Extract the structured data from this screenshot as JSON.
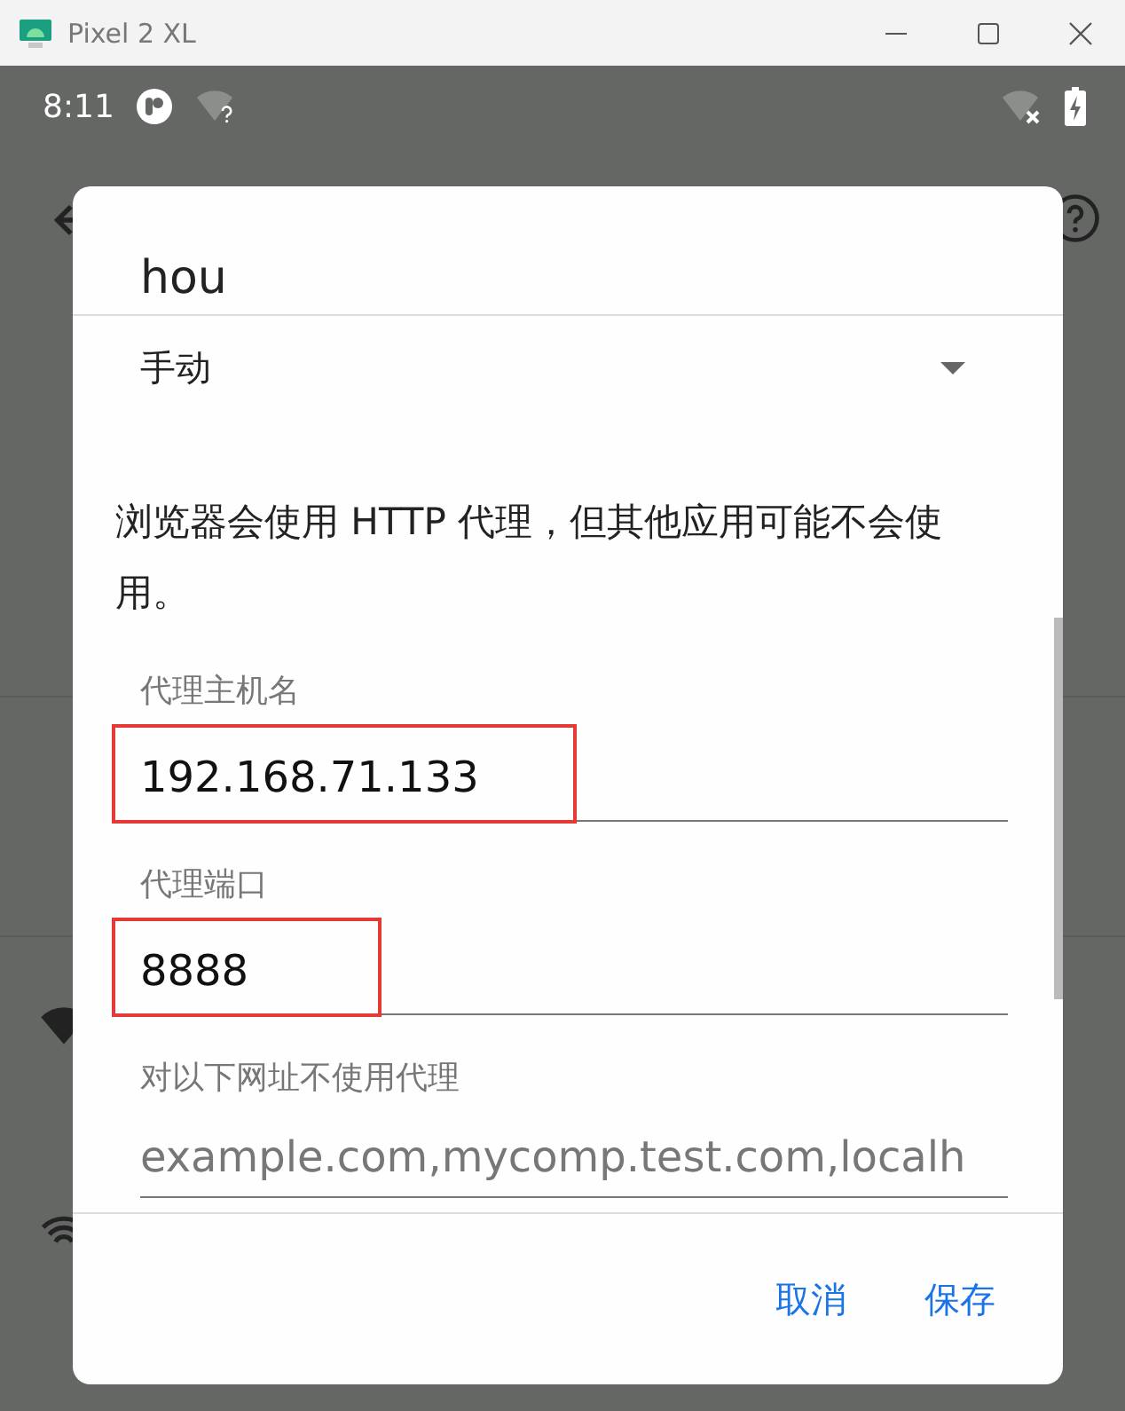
{
  "window": {
    "title": "Pixel 2 XL"
  },
  "status_bar": {
    "time": "8:11"
  },
  "dialog": {
    "title": "hou",
    "proxy_mode": "手动",
    "note": "浏览器会使用 HTTP 代理，但其他应用可能不会使用。",
    "fields": [
      {
        "label": "代理主机名",
        "value": "192.168.71.133",
        "highlighted": true
      },
      {
        "label": "代理端口",
        "value": "8888",
        "highlighted": true
      },
      {
        "label": "对以下网址不使用代理",
        "placeholder": "example.com,mycomp.test.com,localh",
        "highlighted": false
      }
    ],
    "buttons": [
      "取消",
      "保存"
    ]
  }
}
